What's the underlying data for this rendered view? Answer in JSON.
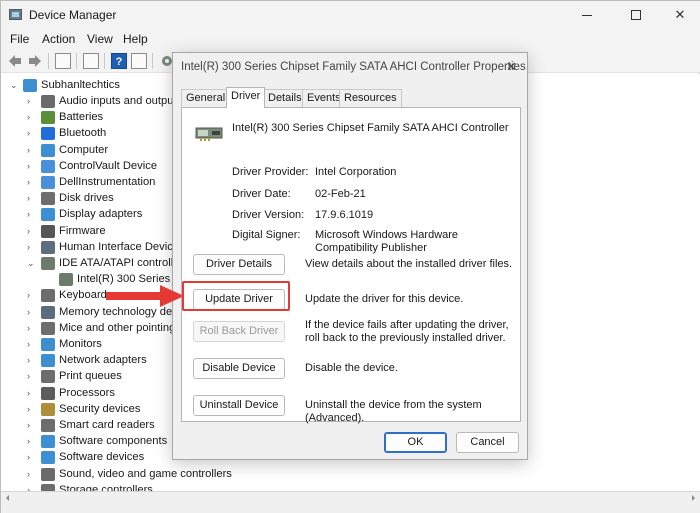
{
  "window": {
    "title": "Device Manager"
  },
  "menu": [
    "File",
    "Action",
    "View",
    "Help"
  ],
  "tree": {
    "root": "Subhanltechtics",
    "items": [
      {
        "label": "Audio inputs and output",
        "icon": "speaker-icon",
        "color": "#6b6b6b",
        "expanded": false
      },
      {
        "label": "Batteries",
        "icon": "battery-icon",
        "color": "#5a8f3a",
        "expanded": false
      },
      {
        "label": "Bluetooth",
        "icon": "bluetooth-icon",
        "color": "#1e6fd9",
        "expanded": false
      },
      {
        "label": "Computer",
        "icon": "computer-icon",
        "color": "#3d8fd1",
        "expanded": false
      },
      {
        "label": "ControlVault Device",
        "icon": "monitor-icon",
        "color": "#4a90d9",
        "expanded": false
      },
      {
        "label": "DellInstrumentation",
        "icon": "monitor-icon",
        "color": "#4a90d9",
        "expanded": false
      },
      {
        "label": "Disk drives",
        "icon": "disk-icon",
        "color": "#6d6d6d",
        "expanded": false
      },
      {
        "label": "Display adapters",
        "icon": "display-icon",
        "color": "#3d8fd1",
        "expanded": false
      },
      {
        "label": "Firmware",
        "icon": "chip-icon",
        "color": "#555555",
        "expanded": false
      },
      {
        "label": "Human Interface Device",
        "icon": "hid-icon",
        "color": "#5d6d7e",
        "expanded": false
      },
      {
        "label": "IDE ATA/ATAPI controlle",
        "icon": "controller-icon",
        "color": "#6d7b6d",
        "expanded": true
      },
      {
        "label": "Intel(R) 300 Series Ch",
        "icon": "controller-icon",
        "color": "#6d7b6d",
        "child": true
      },
      {
        "label": "Keyboards",
        "icon": "keyboard-icon",
        "color": "#6d6d6d",
        "expanded": false
      },
      {
        "label": "Memory technology de",
        "icon": "memory-icon",
        "color": "#5a6d7a",
        "expanded": false
      },
      {
        "label": "Mice and other pointing",
        "icon": "mouse-icon",
        "color": "#6d6d6d",
        "expanded": false
      },
      {
        "label": "Monitors",
        "icon": "monitor-icon",
        "color": "#3d8fd1",
        "expanded": false
      },
      {
        "label": "Network adapters",
        "icon": "network-icon",
        "color": "#3d8fd1",
        "expanded": false
      },
      {
        "label": "Print queues",
        "icon": "printer-icon",
        "color": "#6d6d6d",
        "expanded": false
      },
      {
        "label": "Processors",
        "icon": "processor-icon",
        "color": "#5d5d5d",
        "expanded": false
      },
      {
        "label": "Security devices",
        "icon": "security-icon",
        "color": "#b08d3a",
        "expanded": false
      },
      {
        "label": "Smart card readers",
        "icon": "smartcard-icon",
        "color": "#6d6d6d",
        "expanded": false
      },
      {
        "label": "Software components",
        "icon": "software-icon",
        "color": "#3d8fd1",
        "expanded": false
      },
      {
        "label": "Software devices",
        "icon": "software-icon",
        "color": "#3d8fd1",
        "expanded": false
      },
      {
        "label": "Sound, video and game controllers",
        "icon": "speaker-icon",
        "color": "#6b6b6b",
        "expanded": false
      },
      {
        "label": "Storage controllers",
        "icon": "storage-icon",
        "color": "#6d6d6d",
        "expanded": false
      }
    ]
  },
  "dialog": {
    "title": "Intel(R) 300 Series Chipset Family SATA AHCI Controller Properties",
    "tabs": [
      "General",
      "Driver",
      "Details",
      "Events",
      "Resources"
    ],
    "active_tab": "Driver",
    "device_name": "Intel(R) 300 Series Chipset Family SATA AHCI Controller",
    "props": [
      {
        "label": "Driver Provider:",
        "value": "Intel Corporation"
      },
      {
        "label": "Driver Date:",
        "value": "02-Feb-21"
      },
      {
        "label": "Driver Version:",
        "value": "17.9.6.1019"
      },
      {
        "label": "Digital Signer:",
        "value": "Microsoft Windows Hardware Compatibility Publisher"
      }
    ],
    "actions": [
      {
        "label": "Driver Details",
        "desc": "View details about the installed driver files.",
        "disabled": false
      },
      {
        "label": "Update Driver",
        "desc": "Update the driver for this device.",
        "disabled": false
      },
      {
        "label": "Roll Back Driver",
        "desc": "If the device fails after updating the driver, roll back to the previously installed driver.",
        "disabled": true
      },
      {
        "label": "Disable Device",
        "desc": "Disable the device.",
        "disabled": false
      },
      {
        "label": "Uninstall Device",
        "desc": "Uninstall the device from the system (Advanced).",
        "disabled": false
      }
    ],
    "ok_label": "OK",
    "cancel_label": "Cancel"
  },
  "colors": {
    "highlight": "#e53935",
    "accent": "#2f6ec9"
  }
}
